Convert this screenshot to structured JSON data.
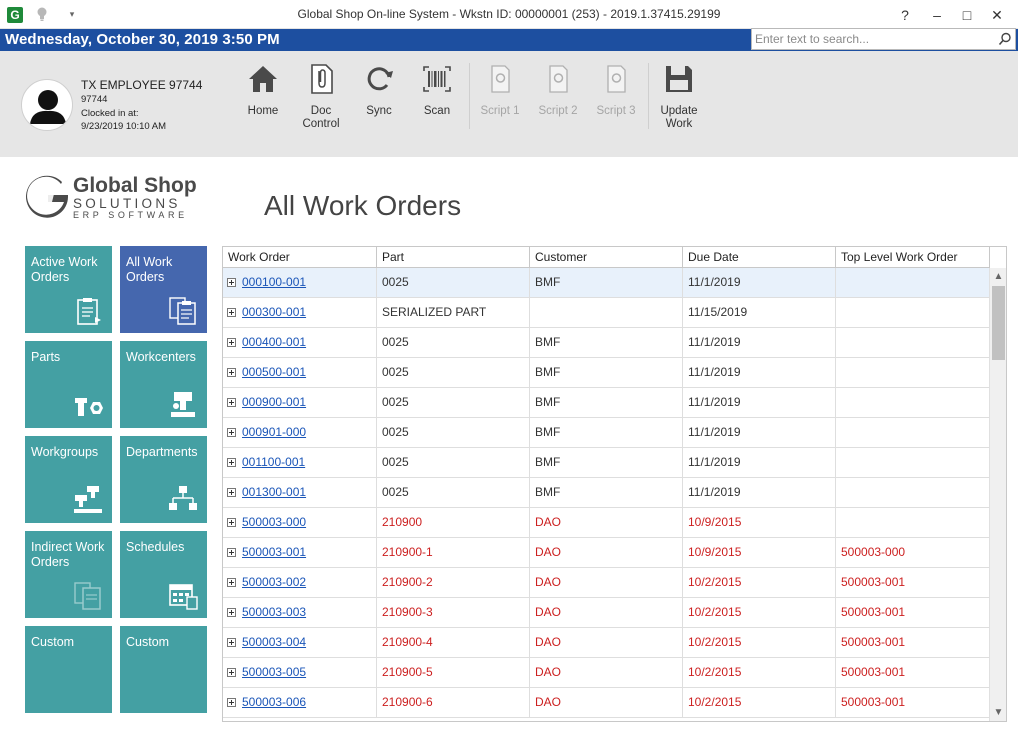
{
  "titlebar": {
    "logo_letter": "G",
    "title": "Global Shop On-line System - Wkstn ID: 00000001 (253) - 2019.1.37415.29199",
    "help": "?",
    "minimize": "–",
    "maximize": "□",
    "close": "✕"
  },
  "datebar": {
    "date_text": "Wednesday, October 30, 2019 3:50 PM",
    "search_placeholder": "Enter text to search..."
  },
  "employee": {
    "name": "TX EMPLOYEE 97744",
    "id": "97744",
    "clocked_label": "Clocked in at:",
    "clocked_time": "9/23/2019 10:10 AM"
  },
  "toolbar": {
    "home": "Home",
    "doc_control_1": "Doc",
    "doc_control_2": "Control",
    "sync": "Sync",
    "scan": "Scan",
    "script1": "Script 1",
    "script2": "Script 2",
    "script3": "Script 3",
    "update_1": "Update",
    "update_2": "Work"
  },
  "logo": {
    "line1": "Global Shop",
    "line2": "SOLUTIONS",
    "line3": "ERP SOFTWARE"
  },
  "page_title": "All Work Orders",
  "tiles": [
    {
      "label": "Active Work Orders",
      "active": false
    },
    {
      "label": "All Work Orders",
      "active": true
    },
    {
      "label": "Parts",
      "active": false
    },
    {
      "label": "Workcenters",
      "active": false
    },
    {
      "label": "Workgroups",
      "active": false
    },
    {
      "label": "Departments",
      "active": false
    },
    {
      "label": "Indirect Work Orders",
      "active": false
    },
    {
      "label": "Schedules",
      "active": false
    },
    {
      "label": "Custom",
      "active": false
    },
    {
      "label": "Custom",
      "active": false
    }
  ],
  "colors": {
    "title_blue": "#1d4fa0",
    "tile_teal": "#44a0a3",
    "tile_active": "#4567ae",
    "link": "#1a55b8",
    "red_text": "#cc1f1f"
  },
  "grid": {
    "headers": [
      "Work Order",
      "Part",
      "Customer",
      "Due Date",
      "Top Level Work Order"
    ],
    "rows": [
      {
        "wo": "000100-001",
        "part": "0025",
        "customer": "BMF",
        "due": "11/1/2019",
        "top": "",
        "red": false,
        "selected": true
      },
      {
        "wo": "000300-001",
        "part": "SERIALIZED PART",
        "customer": "",
        "due": "11/15/2019",
        "top": "",
        "red": false,
        "selected": false
      },
      {
        "wo": "000400-001",
        "part": "0025",
        "customer": "BMF",
        "due": "11/1/2019",
        "top": "",
        "red": false,
        "selected": false
      },
      {
        "wo": "000500-001",
        "part": "0025",
        "customer": "BMF",
        "due": "11/1/2019",
        "top": "",
        "red": false,
        "selected": false
      },
      {
        "wo": "000900-001",
        "part": "0025",
        "customer": "BMF",
        "due": "11/1/2019",
        "top": "",
        "red": false,
        "selected": false
      },
      {
        "wo": "000901-000",
        "part": "0025",
        "customer": "BMF",
        "due": "11/1/2019",
        "top": "",
        "red": false,
        "selected": false
      },
      {
        "wo": "001100-001",
        "part": "0025",
        "customer": "BMF",
        "due": "11/1/2019",
        "top": "",
        "red": false,
        "selected": false
      },
      {
        "wo": "001300-001",
        "part": "0025",
        "customer": "BMF",
        "due": "11/1/2019",
        "top": "",
        "red": false,
        "selected": false
      },
      {
        "wo": "500003-000",
        "part": "210900",
        "customer": "DAO",
        "due": "10/9/2015",
        "top": "",
        "red": true,
        "selected": false
      },
      {
        "wo": "500003-001",
        "part": "210900-1",
        "customer": "DAO",
        "due": "10/9/2015",
        "top": "500003-000",
        "red": true,
        "selected": false
      },
      {
        "wo": "500003-002",
        "part": "210900-2",
        "customer": "DAO",
        "due": "10/2/2015",
        "top": "500003-001",
        "red": true,
        "selected": false
      },
      {
        "wo": "500003-003",
        "part": "210900-3",
        "customer": "DAO",
        "due": "10/2/2015",
        "top": "500003-001",
        "red": true,
        "selected": false
      },
      {
        "wo": "500003-004",
        "part": "210900-4",
        "customer": "DAO",
        "due": "10/2/2015",
        "top": "500003-001",
        "red": true,
        "selected": false
      },
      {
        "wo": "500003-005",
        "part": "210900-5",
        "customer": "DAO",
        "due": "10/2/2015",
        "top": "500003-001",
        "red": true,
        "selected": false
      },
      {
        "wo": "500003-006",
        "part": "210900-6",
        "customer": "DAO",
        "due": "10/2/2015",
        "top": "500003-001",
        "red": true,
        "selected": false
      }
    ]
  }
}
